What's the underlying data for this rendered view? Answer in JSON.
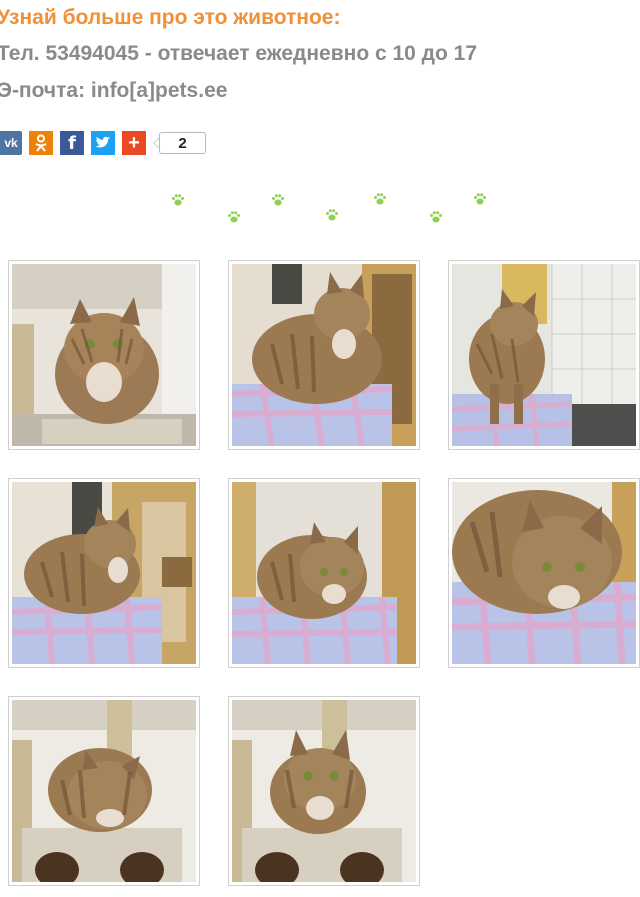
{
  "heading": "Узнай больше про это животное:",
  "phone_line": "Тел. 53494045 - отвечает ежедневно с 10 до 17",
  "email_line": "Э-почта: info[a]pets.ee",
  "share": {
    "buttons": [
      {
        "name": "vk-share-button",
        "icon": "vk-icon",
        "glyph": "vk"
      },
      {
        "name": "odnoklassniki-share-button",
        "icon": "odnoklassniki-icon",
        "glyph": "ok"
      },
      {
        "name": "facebook-share-button",
        "icon": "facebook-icon",
        "glyph": "f"
      },
      {
        "name": "twitter-share-button",
        "icon": "twitter-icon",
        "glyph": "t"
      },
      {
        "name": "more-share-button",
        "icon": "plus-icon",
        "glyph": "+"
      }
    ],
    "count": "2"
  },
  "colors": {
    "heading": "#f0913a",
    "info_text": "#8a8a8a",
    "paw": "#8fd14f",
    "vk": "#4c75a3",
    "ok": "#ee8208",
    "facebook": "#3b5998",
    "twitter": "#1da1f2",
    "plus": "#eb4824"
  },
  "divider_icon": "paw-print-icon",
  "gallery": [
    {
      "name": "cat-photo-1"
    },
    {
      "name": "cat-photo-2"
    },
    {
      "name": "cat-photo-3"
    },
    {
      "name": "cat-photo-4"
    },
    {
      "name": "cat-photo-5"
    },
    {
      "name": "cat-photo-6"
    },
    {
      "name": "cat-photo-7"
    },
    {
      "name": "cat-photo-8"
    }
  ]
}
